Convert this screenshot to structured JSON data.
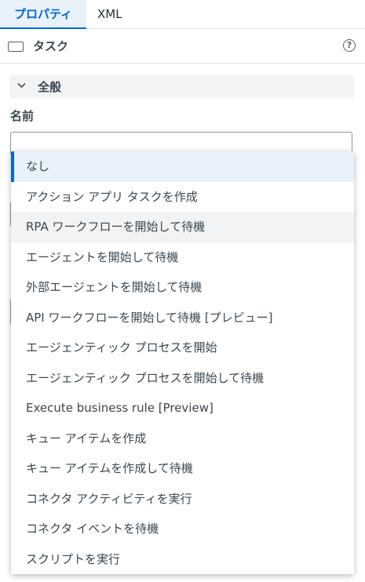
{
  "tabs": {
    "properties": "プロパティ",
    "xml": "XML"
  },
  "header": {
    "title": "タスク",
    "help_icon": "question-circle-icon",
    "task_icon": "rectangle-task-icon"
  },
  "section": {
    "title": "全般",
    "chevron_icon": "chevron-down-icon"
  },
  "name_field": {
    "label": "名前",
    "value": ""
  },
  "dropdown": {
    "selected_index": 0,
    "hovered_index": 2,
    "options": [
      "なし",
      "アクション アプリ タスクを作成",
      "RPA ワークフローを開始して待機",
      "エージェントを開始して待機",
      "外部エージェントを開始して待機",
      "API ワークフローを開始して待機 [プレビュー]",
      "エージェンティック プロセスを開始",
      "エージェンティック プロセスを開始して待機",
      "Execute business rule [Preview]",
      "キュー アイテムを作成",
      "キュー アイテムを作成して待機",
      "コネクタ アクティビティを実行",
      "コネクタ イベントを待機",
      "スクリプトを実行"
    ]
  },
  "colors": {
    "accent": "#0067df",
    "selected_bg": "#e9f1fa",
    "hover_bg": "#f1f3f5"
  }
}
